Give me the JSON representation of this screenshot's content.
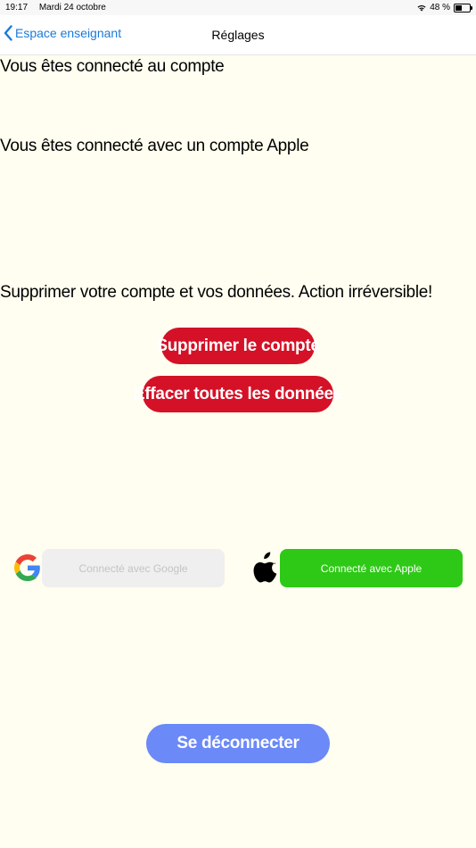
{
  "status_bar": {
    "time": "19:17",
    "date": "Mardi 24 octobre",
    "battery": "48 %",
    "battery_level": 0.48
  },
  "nav": {
    "back_label": "Espace enseignant",
    "title": "Réglages"
  },
  "account": {
    "connected_account_text": "Vous êtes connecté au compte",
    "apple_account_text": "Vous êtes connecté avec un compte Apple",
    "delete_warning": "Supprimer votre compte et vos données. Action irréversible!"
  },
  "buttons": {
    "delete_account": "Supprimer le compte",
    "erase_data": "Effacer toutes les données",
    "logout": "Se déconnecter"
  },
  "providers": {
    "google_label": "Connecté avec Google",
    "apple_label": "Connecté avec Apple"
  },
  "colors": {
    "accent": "#1a7ad9",
    "danger": "#d41127",
    "apple_green": "#2ec916",
    "logout": "#6b89f7",
    "background": "#fffef0"
  }
}
